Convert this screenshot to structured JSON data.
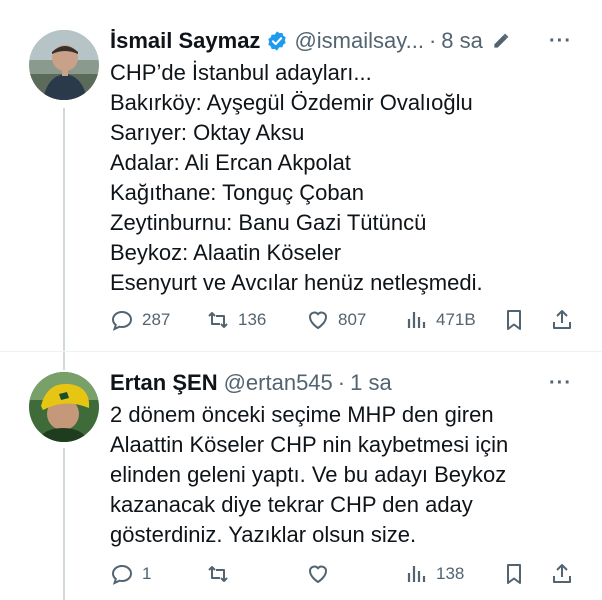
{
  "tweets": [
    {
      "author": {
        "name": "İsmail Saymaz",
        "handle": "@ismailsay...",
        "verified": true,
        "avatar_icon": "avatar-photo-man-outdoors"
      },
      "separator": "·",
      "time": "8 sa",
      "lines": [
        "CHP’de İstanbul adayları...",
        "Bakırköy: Ayşegül Özdemir Ovalıoğlu",
        "Sarıyer: Oktay Aksu",
        "Adalar: Ali Ercan Akpolat",
        "Kağıthane: Tonguç Çoban",
        "Zeytinburnu: Banu Gazi Tütüncü",
        "Beykoz: Alaatin Köseler",
        "Esenyurt ve Avcılar henüz netleşmedi."
      ],
      "more_label": "···",
      "actions": {
        "replies": "287",
        "retweets": "136",
        "likes": "807",
        "views": "471B"
      }
    },
    {
      "author": {
        "name": "Ertan ŞEN",
        "handle": "@ertan545",
        "verified": false,
        "avatar_icon": "avatar-photo-man-yellow-cap"
      },
      "separator": "·",
      "time": "1 sa",
      "lines": [
        "2 dönem önceki seçime MHP den giren",
        "Alaattin Köseler CHP nin kaybetmesi için",
        "elinden geleni yaptı. Ve bu adayı Beykoz",
        "kazanacak diye tekrar CHP den aday",
        "gösterdiniz. Yazıklar olsun size."
      ],
      "more_label": "···",
      "actions": {
        "replies": "1",
        "retweets": "",
        "likes": "",
        "views": "138"
      }
    }
  ],
  "colors": {
    "text": "#0f1419",
    "muted": "#536471",
    "verified": "#1d9bf0",
    "thread_line": "#cfd9de"
  }
}
